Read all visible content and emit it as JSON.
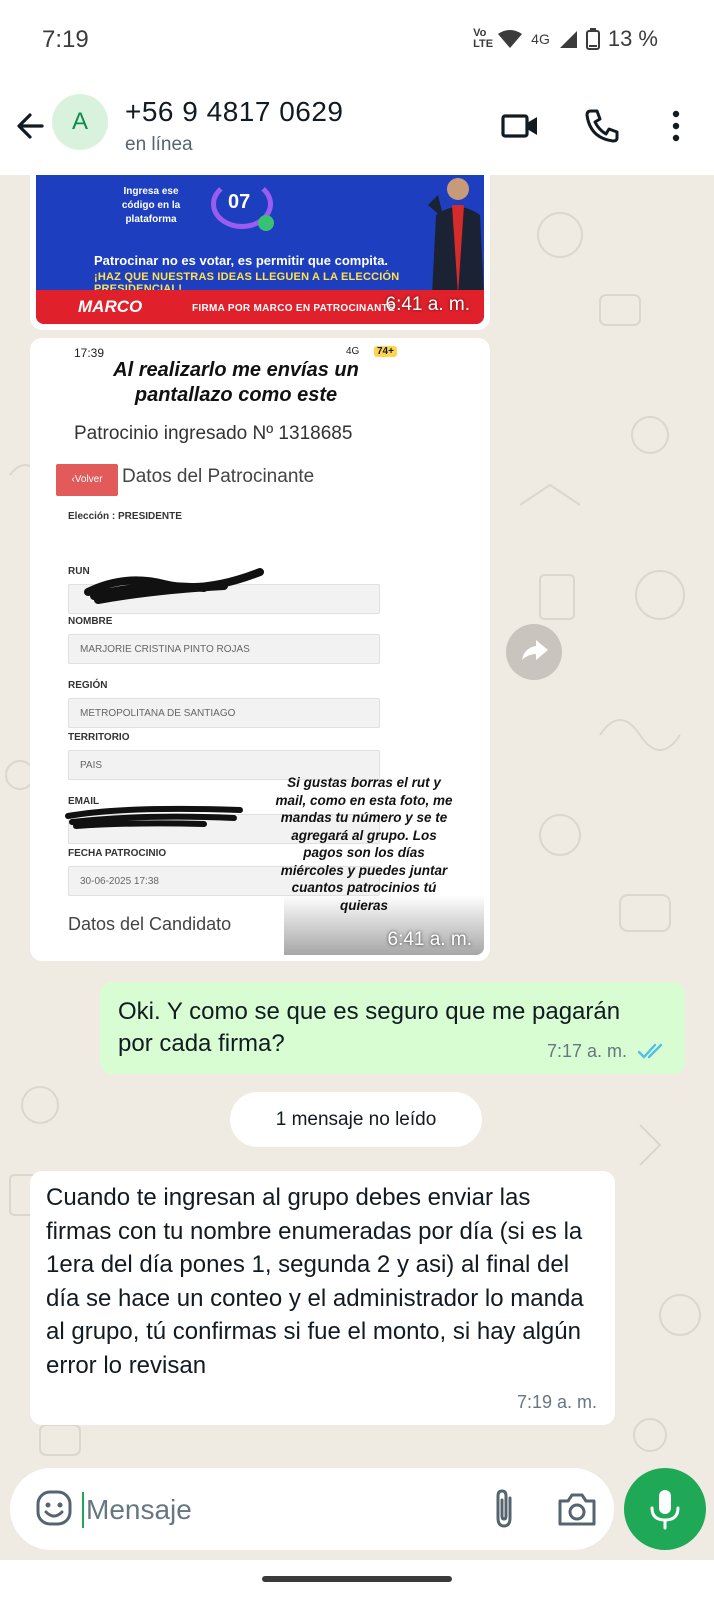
{
  "status_bar": {
    "time": "7:19",
    "volte": "Vo LTE",
    "network": "4G",
    "battery": "13 %"
  },
  "header": {
    "avatar_letter": "A",
    "contact_name": "+56 9 4817 0629",
    "contact_status": "en línea"
  },
  "messages": {
    "poster": {
      "code_text": "Ingresa ese código en la plataforma",
      "code_number": "07",
      "line1": "Patrocinar no es votar, es permitir que compita.",
      "line2": "¡HAZ QUE NUESTRAS IDEAS LLEGUEN A LA ELECCIÓN PRESIDENCIAL!",
      "logo": "MARCO",
      "firma": "FIRMA POR MARCO EN PATROCINANTE",
      "time": "6:41 a. m."
    },
    "screenshot": {
      "clock": "17:39",
      "signal": "4G",
      "battery": "74+",
      "title": "Al realizarlo me envías un pantallazo como este",
      "patrocinio": "Patrocinio ingresado Nº 1318685",
      "volver": "‹Volver",
      "datos_patrocinante": "Datos del Patrocinante",
      "eleccion": "Elección : PRESIDENTE",
      "run_label": "RUN",
      "nombre_label": "NOMBRE",
      "nombre_value": "MARJORIE CRISTINA PINTO ROJAS",
      "region_label": "REGIÓN",
      "region_value": "METROPOLITANA DE SANTIAGO",
      "territorio_label": "TERRITORIO",
      "territorio_value": "PAIS",
      "email_label": "EMAIL",
      "fecha_label": "FECHA PATROCINIO",
      "fecha_value": "30-06-2025 17:38",
      "datos_candidato": "Datos del Candidato",
      "caption": "Si gustas borras el rut y mail, como en esta foto, me mandas tu número y se te agregará al grupo. Los pagos son los días miércoles y puedes juntar cuantos patrocinios tú quieras",
      "time": "6:41 a. m."
    },
    "outgoing": {
      "text": "Oki. Y como se que es seguro que me pagarán por cada firma?",
      "time": "7:17 a. m."
    },
    "unread_divider": "1 mensaje no leído",
    "incoming": {
      "text": "Cuando te ingresan al grupo debes enviar las firmas con tu nombre enumeradas por día (si es la 1era del día pones 1, segunda 2 y asi) al final del día se hace un conteo y el administrador lo manda al grupo, tú confirmas si fue el monto, si hay algún error lo revisan",
      "time": "7:19 a. m."
    }
  },
  "composer": {
    "placeholder": "Mensaje"
  },
  "colors": {
    "chat_bg": "#efeae2",
    "outgoing_bubble": "#d9fdd3",
    "accent_green": "#1fa855",
    "read_ticks": "#53bdeb"
  },
  "icons": [
    "back-arrow-icon",
    "video-call-icon",
    "phone-icon",
    "more-options-icon",
    "forward-icon",
    "read-ticks-icon",
    "emoji-icon",
    "attach-icon",
    "camera-icon",
    "mic-icon"
  ]
}
